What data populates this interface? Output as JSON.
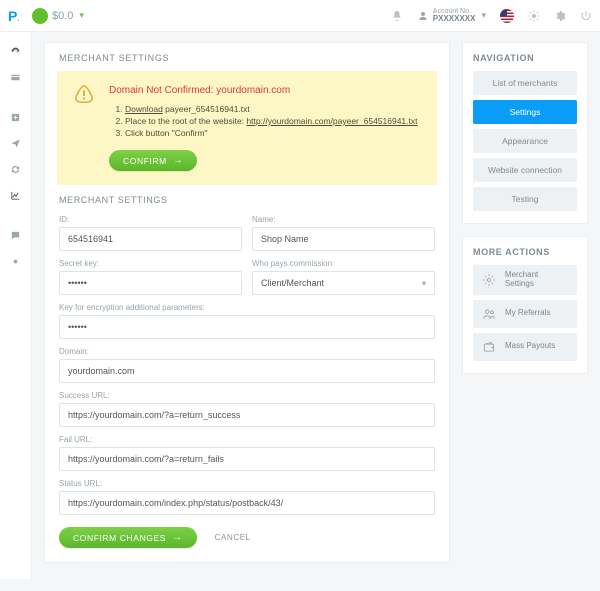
{
  "topbar": {
    "balance": "$0.0",
    "account_label": "Account No.",
    "account_no": "PXXXXXXX"
  },
  "rail": {
    "items": [
      "dashboard",
      "wallet",
      "",
      "add",
      "send",
      "exchange",
      "stats",
      "",
      "chat",
      "dot"
    ]
  },
  "page": {
    "title": "MERCHANT SETTINGS"
  },
  "notice": {
    "heading": "Domain Not Confirmed:",
    "domain": "yourdomain.com",
    "step1a": "Download",
    "step1b": " payeer_654516941.txt",
    "step2a": "Place to the root of the website: ",
    "step2b": "http://yourdomain.com/payeer_654516941.txt",
    "step3": "Click button \"Confirm\"",
    "confirm_label": "CONFIRM"
  },
  "form": {
    "subtitle": "MERCHANT SETTINGS",
    "id_label": "ID:",
    "id_value": "654516941",
    "name_label": "Name:",
    "name_value": "Shop Name",
    "secret_label": "Secret key:",
    "secret_value": "••••••",
    "commission_label": "Who pays commission:",
    "commission_value": "Client/Merchant",
    "enckey_label": "Key for encryption additional parameters:",
    "enckey_value": "••••••",
    "domain_label": "Domain:",
    "domain_value": "yourdomain.com",
    "success_label": "Success URL:",
    "success_value": "https://yourdomain.com/?a=return_success",
    "fail_label": "Fail URL:",
    "fail_value": "https://yourdomain.com/?a=return_fails",
    "status_label": "Status URL:",
    "status_value": "https://yourdomain.com/index.php/status/postback/43/",
    "confirm_changes_label": "CONFIRM CHANGES",
    "cancel_label": "CANCEL"
  },
  "sidebar": {
    "nav_title": "NAVIGATION",
    "items": [
      {
        "label": "List of merchants"
      },
      {
        "label": "Settings"
      },
      {
        "label": "Appearance"
      },
      {
        "label": "Website connection"
      },
      {
        "label": "Testing"
      }
    ],
    "more_title": "MORE ACTIONS",
    "more": [
      {
        "label": "Merchant Settings"
      },
      {
        "label": "My Referrals"
      },
      {
        "label": "Mass Payouts"
      }
    ]
  }
}
